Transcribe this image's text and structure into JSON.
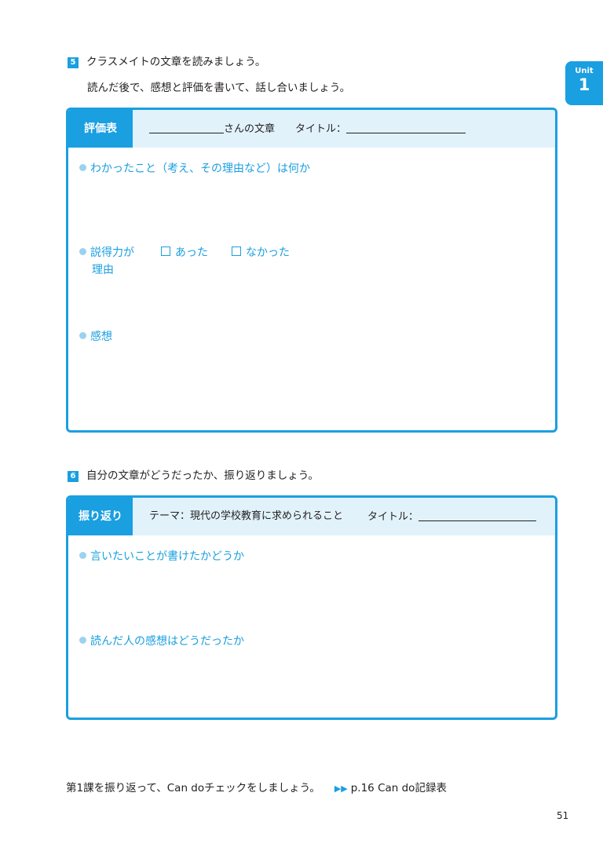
{
  "unit_tab": {
    "label": "Unit",
    "number": "1"
  },
  "section5": {
    "number": "5",
    "line1": "クラスメイトの文章を読みましょう。",
    "line2": "読んだ後で、感想と評価を書いて、話し合いましょう。"
  },
  "eval_box": {
    "tag": "評価表",
    "author_suffix": "さんの文章",
    "title_label": "タイトル：",
    "item1": "わかったこと（考え、その理由など）は何か",
    "item2_label": "説得力が",
    "item2_cont": "理由",
    "option_yes": "あった",
    "option_no": "なかった",
    "item3": "感想"
  },
  "section6": {
    "number": "6",
    "line1": "自分の文章がどうだったか、振り返りましょう。"
  },
  "reflect_box": {
    "tag": "振り返り",
    "theme": "テーマ：現代の学校教育に求められること",
    "title_label": "タイトル：",
    "item1": "言いたいことが書けたかどうか",
    "item2": "読んだ人の感想はどうだったか"
  },
  "footer": {
    "text": "第1課を振り返って、Can doチェックをしましょう。",
    "arrows": "▶▶",
    "link": "p.16 Can do記録表"
  },
  "page_number": "51",
  "colors": {
    "accent": "#1a9fe0",
    "header_bg": "#e1f2fb",
    "dot": "#9ad2f2"
  }
}
